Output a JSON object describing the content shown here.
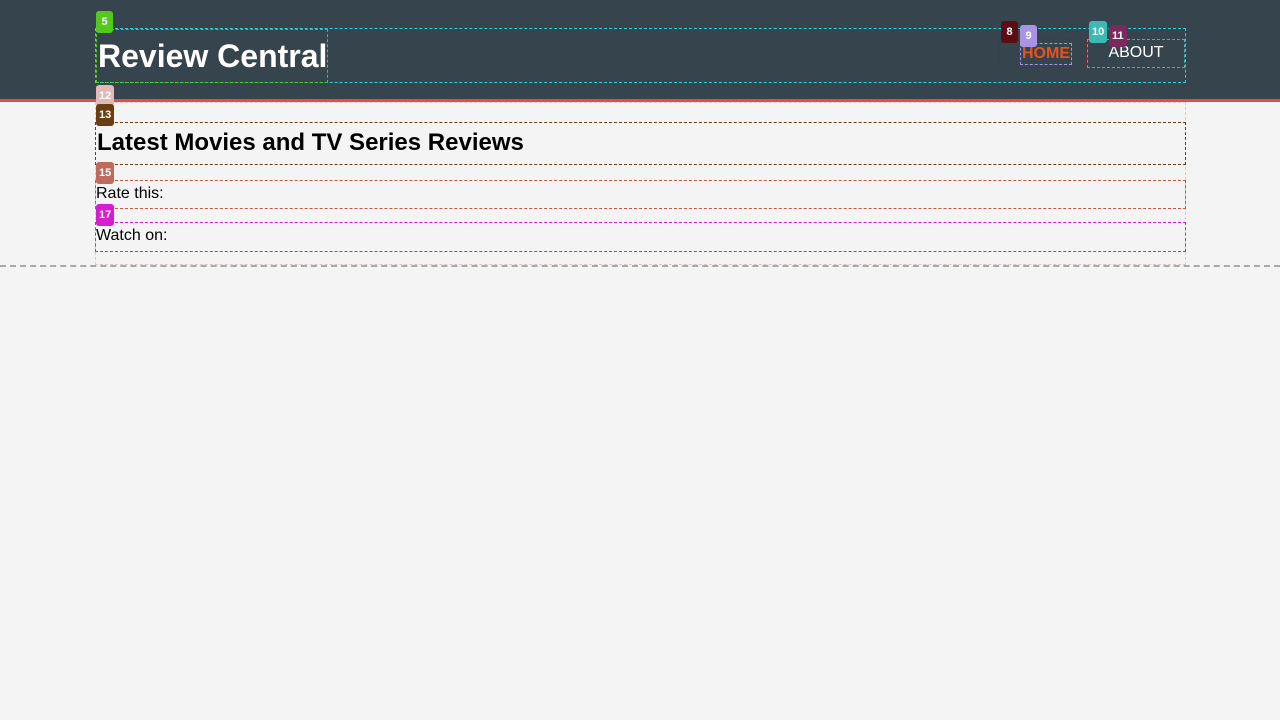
{
  "header": {
    "logo_text": "Review Central",
    "nav": {
      "home_label": "HOME",
      "about_label": "ABOUT"
    }
  },
  "main": {
    "section_title": "Latest Movies and TV Series Reviews",
    "rate_label": "Rate this:",
    "watch_label": "Watch on:"
  },
  "badges": {
    "b5": "5",
    "b8": "8",
    "b9": "9",
    "b10": "10",
    "b11": "11",
    "b12": "12",
    "b13": "13",
    "b15": "15",
    "b17": "17"
  },
  "colors": {
    "header_bg": "#36444d",
    "header_accent": "#e34d48",
    "nav_active": "#e8521c",
    "page_bg": "#f4f4f4"
  }
}
